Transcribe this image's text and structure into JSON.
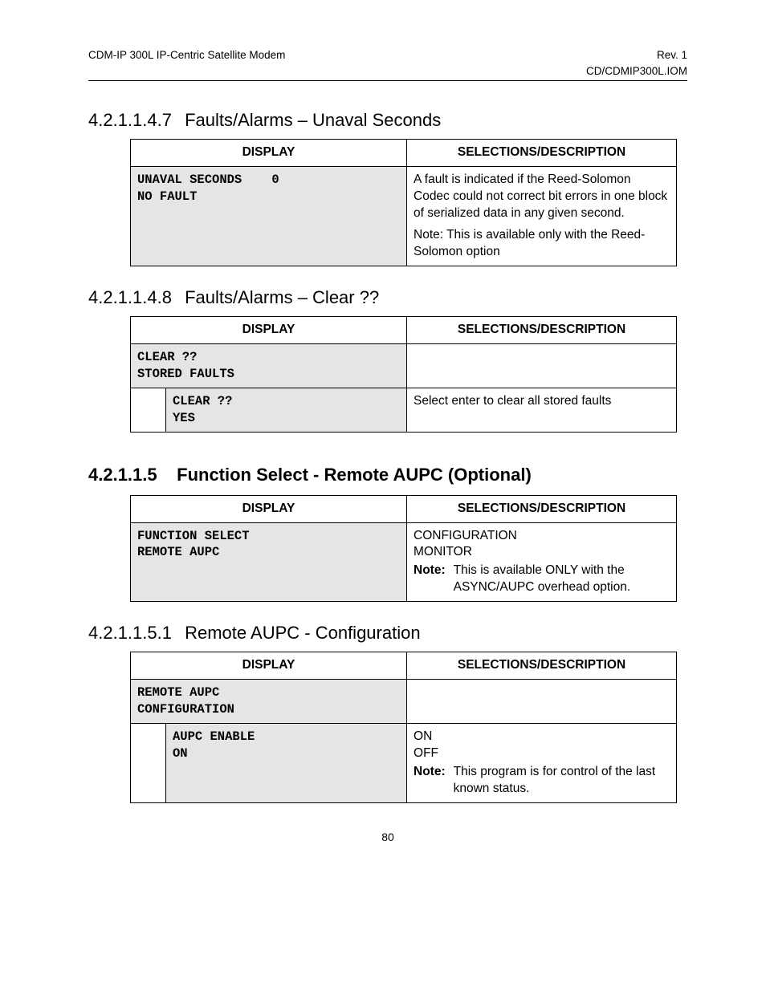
{
  "header": {
    "left_line1": "CDM-IP 300L IP-Centric Satellite Modem",
    "right_line1": "Rev. 1",
    "right_line2": "CD/CDMIP300L.IOM"
  },
  "col_display": "DISPLAY",
  "col_desc": "SELECTIONS/DESCRIPTION",
  "sec47": {
    "num": "4.2.1.1.4.7",
    "title": "Faults/Alarms – Unaval Seconds",
    "lcd": "UNAVAL SECONDS    0\nNO FAULT",
    "desc_p1": "A fault is indicated if the Reed-Solomon Codec could not correct bit errors in one block of serialized data in any given second.",
    "desc_p2": "Note: This is available only with the Reed-Solomon option"
  },
  "sec48": {
    "num": "4.2.1.1.4.8",
    "title": "Faults/Alarms – Clear ??",
    "lcd1": "CLEAR ??\nSTORED FAULTS",
    "desc1": "",
    "lcd2": "CLEAR ??\nYES",
    "desc2": "Select enter to clear all stored faults"
  },
  "sec5": {
    "num": "4.2.1.1.5",
    "title": "Function Select - Remote AUPC (Optional)",
    "lcd": "FUNCTION SELECT\nREMOTE AUPC",
    "desc_l1": "CONFIGURATION",
    "desc_l2": "MONITOR",
    "note_label": "Note:",
    "note_text": "This is available ONLY with the ASYNC/AUPC overhead option."
  },
  "sec51": {
    "num": "4.2.1.1.5.1",
    "title": "Remote AUPC - Configuration",
    "lcd1": "REMOTE AUPC\nCONFIGURATION",
    "desc1": "",
    "lcd2": "AUPC ENABLE\nON",
    "desc2_l1": "ON",
    "desc2_l2": "OFF",
    "note_label": "Note:",
    "note_text": "This program is for control of the last known status."
  },
  "footer": "80"
}
